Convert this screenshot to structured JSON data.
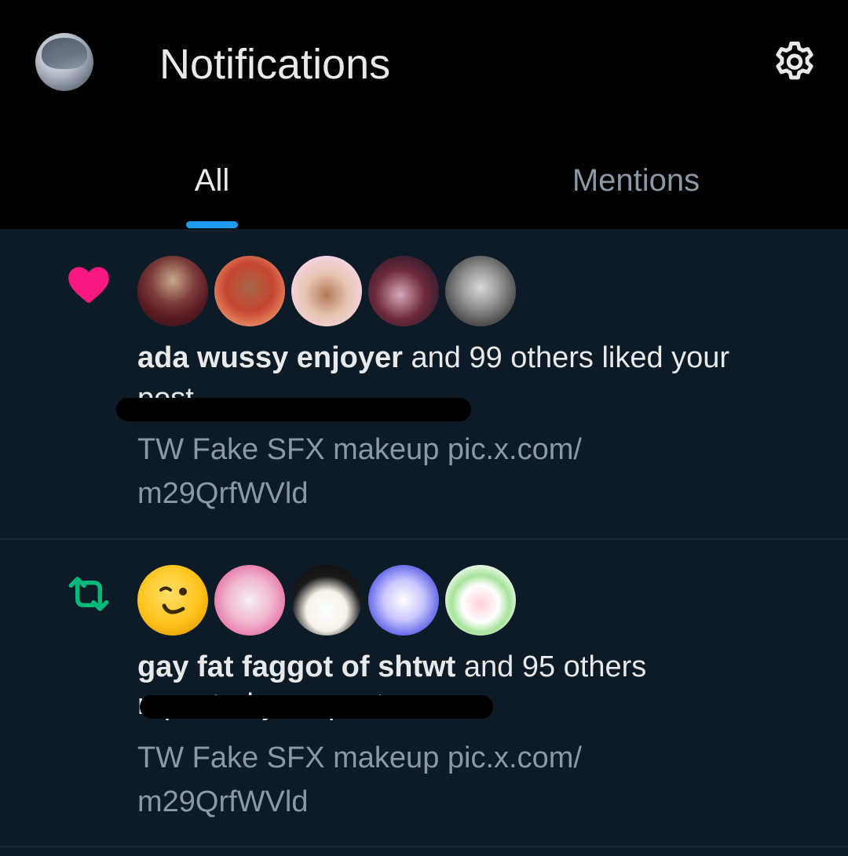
{
  "header": {
    "title": "Notifications",
    "profile_avatar_icon": "user-avatar",
    "settings_icon": "gear-icon"
  },
  "tabs": [
    {
      "label": "All",
      "active": true
    },
    {
      "label": "Mentions",
      "active": false
    }
  ],
  "colors": {
    "background": "#0d1b26",
    "header_background": "#000000",
    "accent": "#1d9bf0",
    "like": "#f91880",
    "repost": "#00ba7c",
    "muted_text": "#8b98a5"
  },
  "notifications": [
    {
      "type": "like",
      "icon": "heart-icon",
      "actor": "ada wussy enjoyer",
      "action": " and 99 others liked your",
      "redacted_line": "post",
      "preview": "TW Fake SFX makeup pic.x.com/\nm29QrfWVld",
      "avatar_count": 5
    },
    {
      "type": "repost",
      "icon": "repost-icon",
      "actor": "gay fat faggot of shtwt",
      "action": " and 95 others",
      "redacted_line": "reposted your post",
      "preview": "TW Fake SFX makeup pic.x.com/\nm29QrfWVld",
      "avatar_count": 5
    }
  ]
}
